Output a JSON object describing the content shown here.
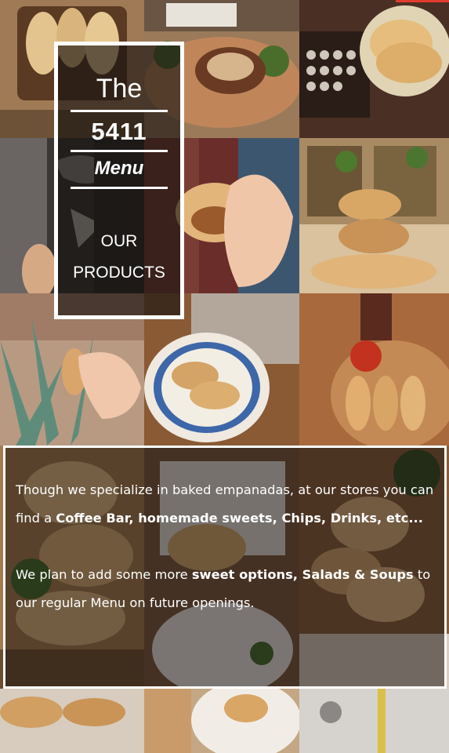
{
  "title_card": {
    "line1": "The",
    "line2": "5411",
    "line3": "Menu",
    "line4": "OUR",
    "line5": "PRODUCTS"
  },
  "info": {
    "p1_a": "Though we specialize in baked empanadas, at our stores you can find a ",
    "p1_b": "Coffee Bar, homemade sweets, Chips, Drinks, etc...",
    "p2_a": "We plan to add some more ",
    "p2_b": "sweet options, Salads & Soups",
    "p2_c": " to our regular Menu on future openings."
  },
  "colors": {
    "accent_red": "#e23b2e",
    "overlay_dark": "#1a1512",
    "text": "#ffffff"
  },
  "photos": [
    "empanadas-on-board-photo",
    "empanada-with-salsa-photo",
    "empanadas-on-plate-typewriter-photo",
    "graffiti-wall-photo",
    "hand-holding-empanada-photo",
    "stacked-empanadas-photo",
    "agave-hand-empanada-photo",
    "empanadas-plate-magazine-photo",
    "empanadas-board-sauce-photo",
    "empanadas-tray-photo",
    "baked-empanadas-plate-photo",
    "empanadas-closeup-photo",
    "bottom-empanadas-photo",
    "bottom-plate-photo",
    "bottom-street-photo"
  ]
}
